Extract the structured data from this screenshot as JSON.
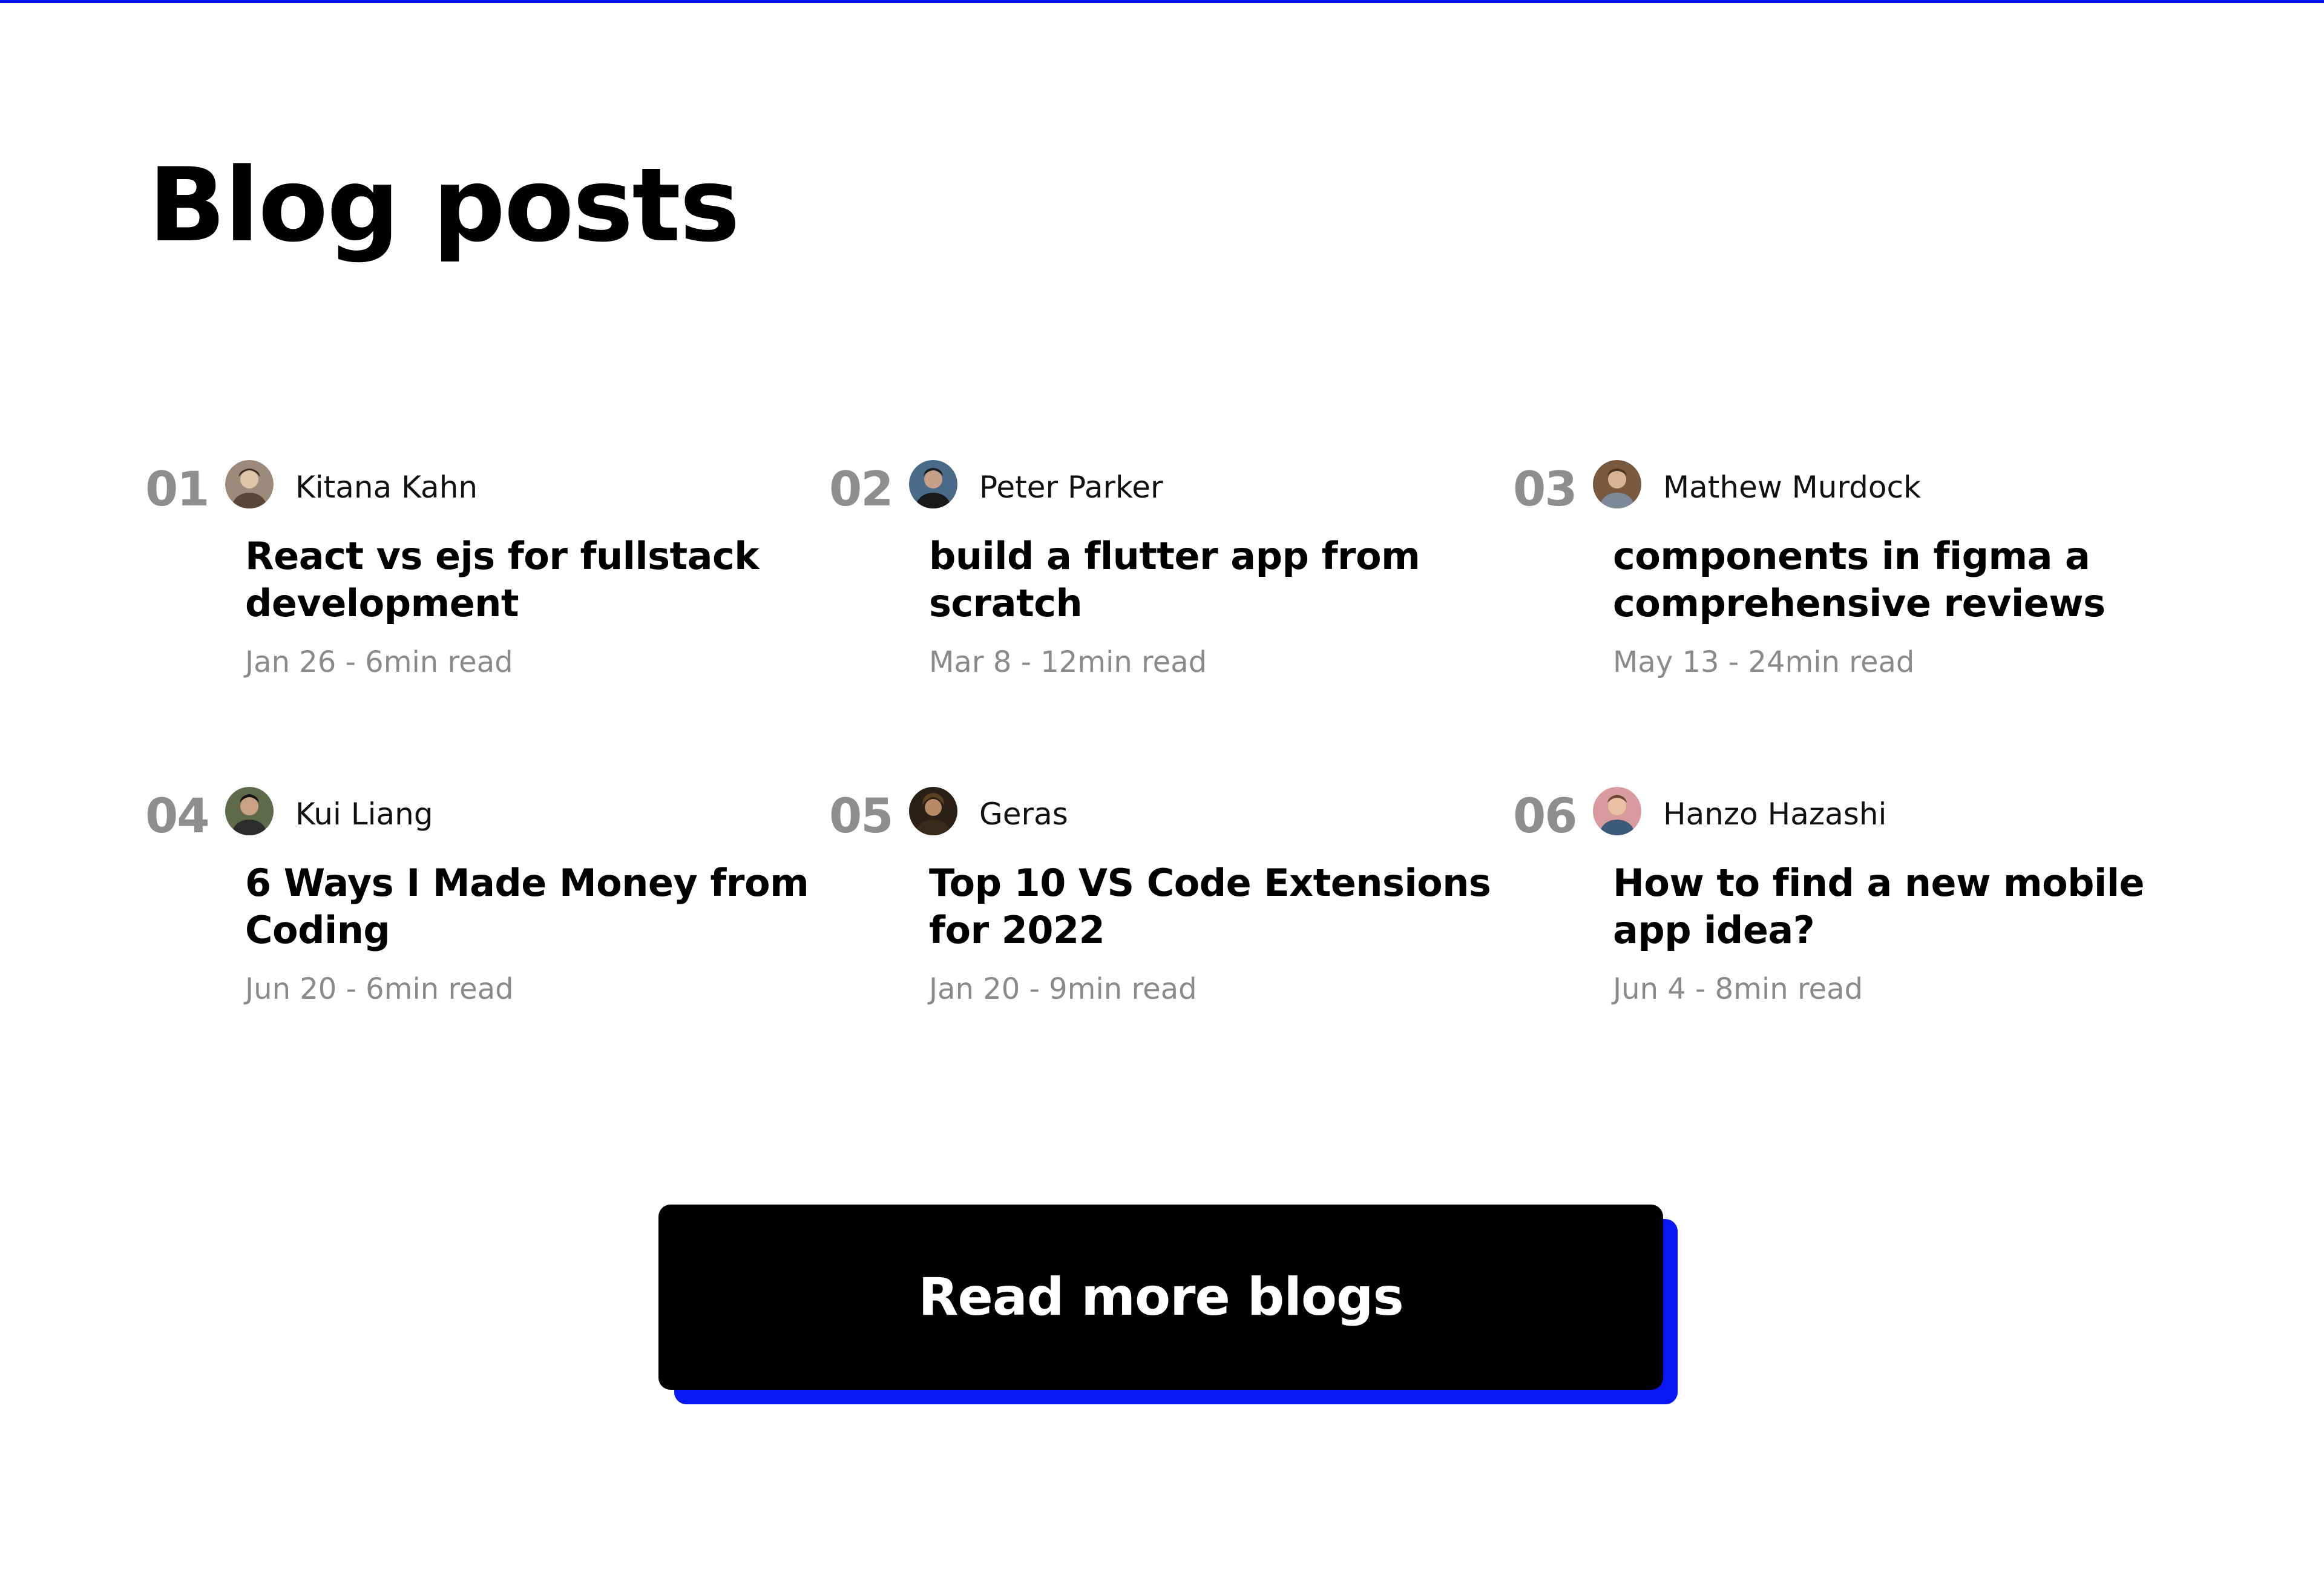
{
  "page": {
    "title": "Blog posts",
    "accent_color": "#0a17f5"
  },
  "posts": [
    {
      "number": "01",
      "author": "Kitana Kahn",
      "avatar_icon": "author-avatar",
      "title": "React vs ejs for fullstack development",
      "meta": "Jan 26 - 6min read"
    },
    {
      "number": "02",
      "author": "Peter Parker",
      "avatar_icon": "author-avatar",
      "title": "build a flutter app from scratch",
      "meta": "Mar 8 - 12min read"
    },
    {
      "number": "03",
      "author": "Mathew Murdock",
      "avatar_icon": "author-avatar",
      "title": "components in figma a comprehensive reviews",
      "meta": "May 13 - 24min read"
    },
    {
      "number": "04",
      "author": "Kui Liang",
      "avatar_icon": "author-avatar",
      "title": "6 Ways I Made Money from Coding",
      "meta": "Jun 20 - 6min read"
    },
    {
      "number": "05",
      "author": "Geras",
      "avatar_icon": "author-avatar",
      "title": "Top 10 VS Code Extensions for 2022",
      "meta": "Jan 20 - 9min read"
    },
    {
      "number": "06",
      "author": "Hanzo Hazashi",
      "avatar_icon": "author-avatar",
      "title": "How to find a new mobile app idea?",
      "meta": "Jun 4 - 8min read"
    }
  ],
  "cta": {
    "label": "Read more blogs",
    "shadow_color": "#0a17f5"
  }
}
